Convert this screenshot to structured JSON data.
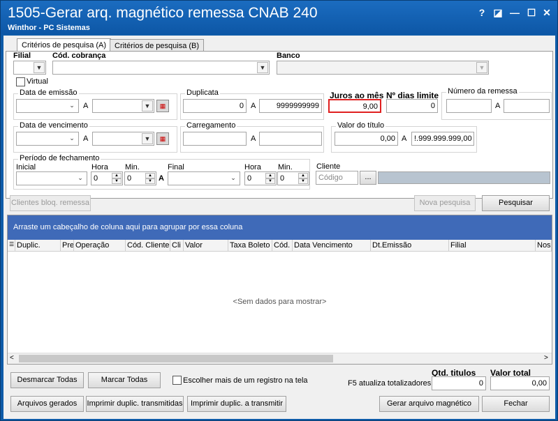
{
  "window": {
    "title": "1505-Gerar arq. magnético remessa CNAB 240",
    "subtitle": "Winthor - PC Sistemas",
    "help": "?",
    "restore": "◪",
    "minimize": "—",
    "maximize": "☐",
    "close": "✕"
  },
  "tabs": [
    {
      "label": "Critérios de pesquisa (A)"
    },
    {
      "label": "Critérios de pesquisa (B)"
    }
  ],
  "filters": {
    "filial_label": "Filial",
    "cod_cobranca_label": "Cód. cobrança",
    "banco_label": "Banco",
    "virtual_label": "Virtual",
    "data_emissao_label": "Data de emissão",
    "a_label": "A",
    "duplicata_label": "Duplicata",
    "duplicata_from": "0",
    "duplicata_to": "9999999999",
    "juros_label": "Juros ao mês",
    "juros_value": "9,00",
    "dias_limite_label": "Nº dias limite",
    "dias_limite_value": "0",
    "numero_remessa_label": "Número da remessa",
    "data_vencimento_label": "Data de vencimento",
    "carregamento_label": "Carregamento",
    "valor_titulo_label": "Valor do título",
    "valor_from": "0,00",
    "valor_to": "!.999.999.999,00",
    "periodo_label": "Período de fechamento",
    "inicial_label": "Inicial",
    "hora_label": "Hora",
    "min_label": "Min.",
    "final_label": "Final",
    "a_bold": "A",
    "hora_inicial": "0",
    "min_inicial": "0",
    "hora_final": "0",
    "min_final": "0",
    "cliente_label": "Cliente",
    "cliente_placeholder": "Código",
    "ellipsis": "..."
  },
  "actions": {
    "clientes_bloq": "Clientes bloq. remessa",
    "nova_pesquisa": "Nova pesquisa",
    "pesquisar": "Pesquisar"
  },
  "grid": {
    "group_hint": "Arraste um cabeçalho de coluna aqui para agrupar por essa coluna",
    "columns": [
      "Duplic.",
      "Pre",
      "Operação",
      "Cód. Cliente",
      "Cli",
      "Valor",
      "Taxa Boleto",
      "Cód.",
      "Data Vencimento",
      "Dt.Emissão",
      "Filial",
      "Nos"
    ],
    "empty_text": "<Sem dados para mostrar>"
  },
  "footer": {
    "desmarcar_todas": "Desmarcar Todas",
    "marcar_todas": "Marcar Todas",
    "escolher_label": "Escolher mais de um registro na tela",
    "qtd_titulos_label": "Qtd. titulos",
    "qtd_titulos_value": "0",
    "valor_total_label": "Valor total",
    "valor_total_value": "0,00",
    "f5_label": "F5 atualiza totalizadores",
    "arquivos_gerados": "Arquivos gerados",
    "imprimir_transmitidas": "Imprimir duplic. transmitidas",
    "imprimir_a_transmitir": "Imprimir duplic. a transmitir",
    "gerar_arquivo": "Gerar arquivo magnético",
    "fechar": "Fechar"
  },
  "colors": {
    "title_bar": "#0d57a6",
    "group_bar": "#3f6ab8",
    "highlight": "#e02020"
  }
}
